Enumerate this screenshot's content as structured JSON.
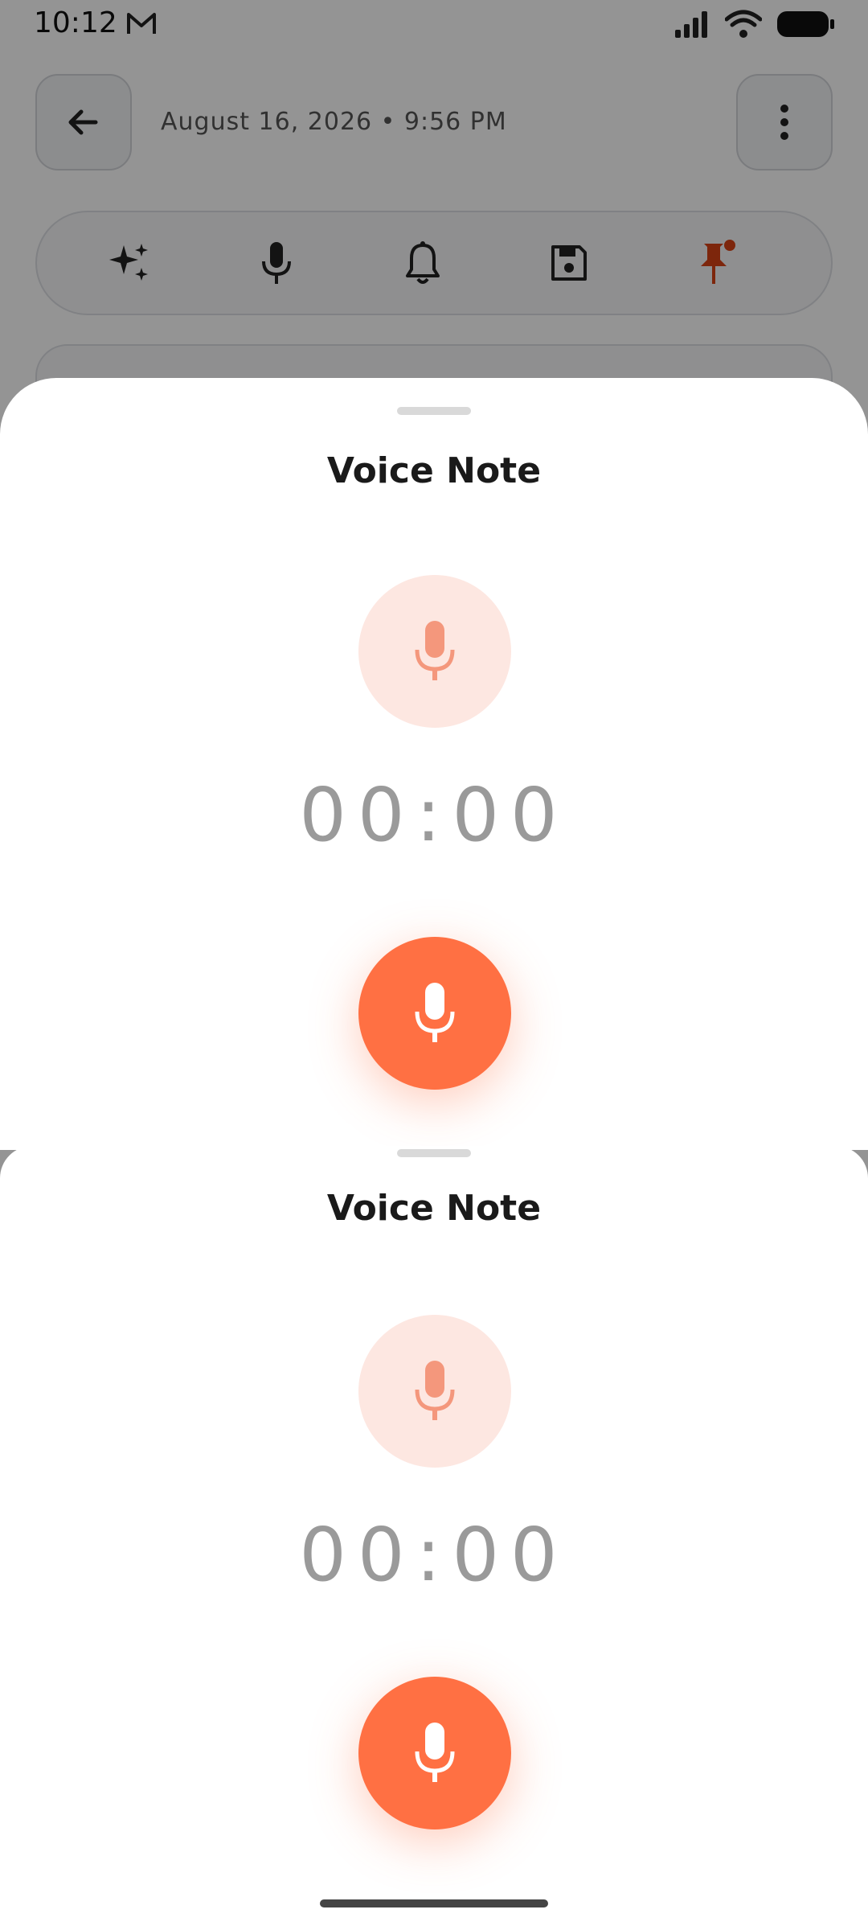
{
  "status_bar": {
    "time": "10:12"
  },
  "header": {
    "date": "August 16, 2026 • 9:56 PM"
  },
  "toolbar": {
    "icons": [
      "sparkle-icon",
      "microphone-icon",
      "bell-icon",
      "save-icon",
      "pin-icon"
    ]
  },
  "voice_note_sheet_1": {
    "title": "Voice Note",
    "timer": "00:00"
  },
  "voice_note_sheet_2": {
    "title": "Voice Note",
    "timer": "00:00"
  },
  "colors": {
    "accent": "#FF7043",
    "accent_light": "#FDE7E1",
    "pin": "#D84315"
  }
}
